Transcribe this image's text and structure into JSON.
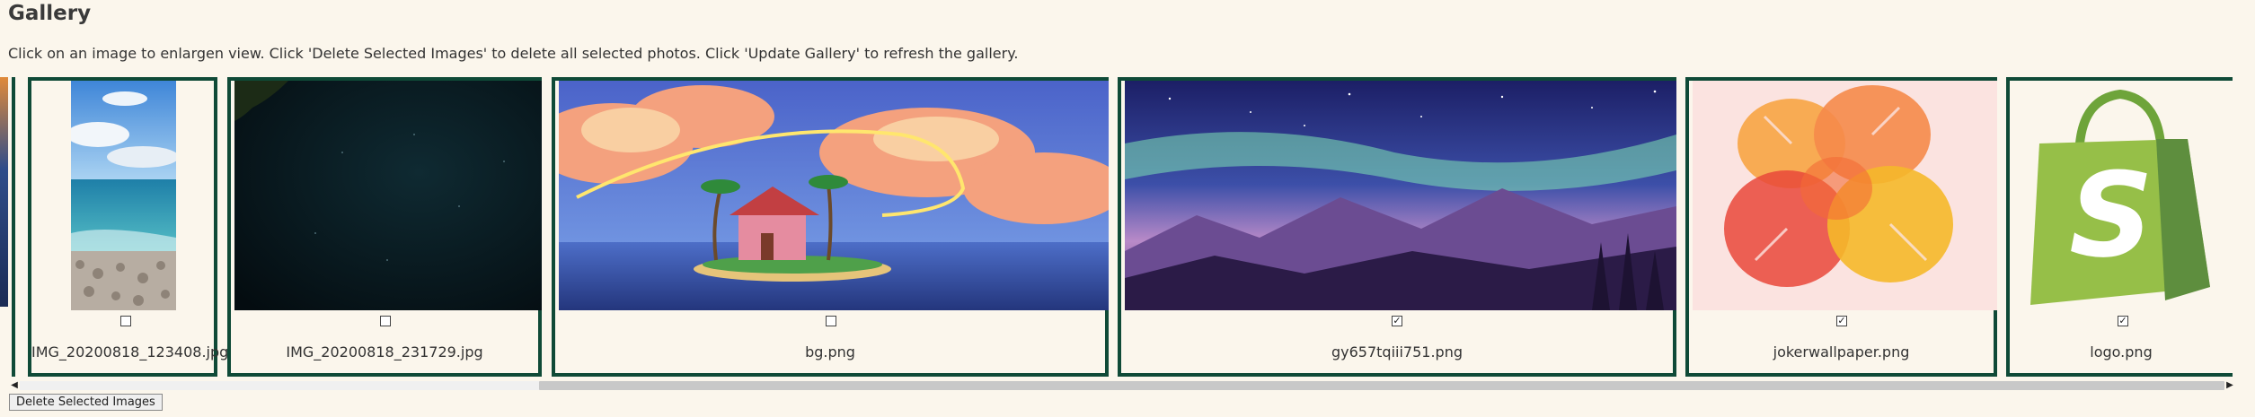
{
  "page": {
    "title": "Gallery",
    "instructions": "Click on an image to enlargen view. Click 'Delete Selected Images' to delete all selected photos. Click 'Update Gallery' to refresh the gallery."
  },
  "gallery": {
    "images": [
      {
        "filename": "IMG_20200818_123408.jpg",
        "selected": false
      },
      {
        "filename": "IMG_20200818_231729.jpg",
        "selected": false
      },
      {
        "filename": "bg.png",
        "selected": false
      },
      {
        "filename": "gy657tqiii751.png",
        "selected": true
      },
      {
        "filename": "jokerwallpaper.png",
        "selected": true
      },
      {
        "filename": "logo.png",
        "selected": true
      }
    ]
  },
  "actions": {
    "delete_label": "Delete Selected Images"
  },
  "colors": {
    "card_border": "#0f4a37",
    "background": "#fbf6ec"
  }
}
